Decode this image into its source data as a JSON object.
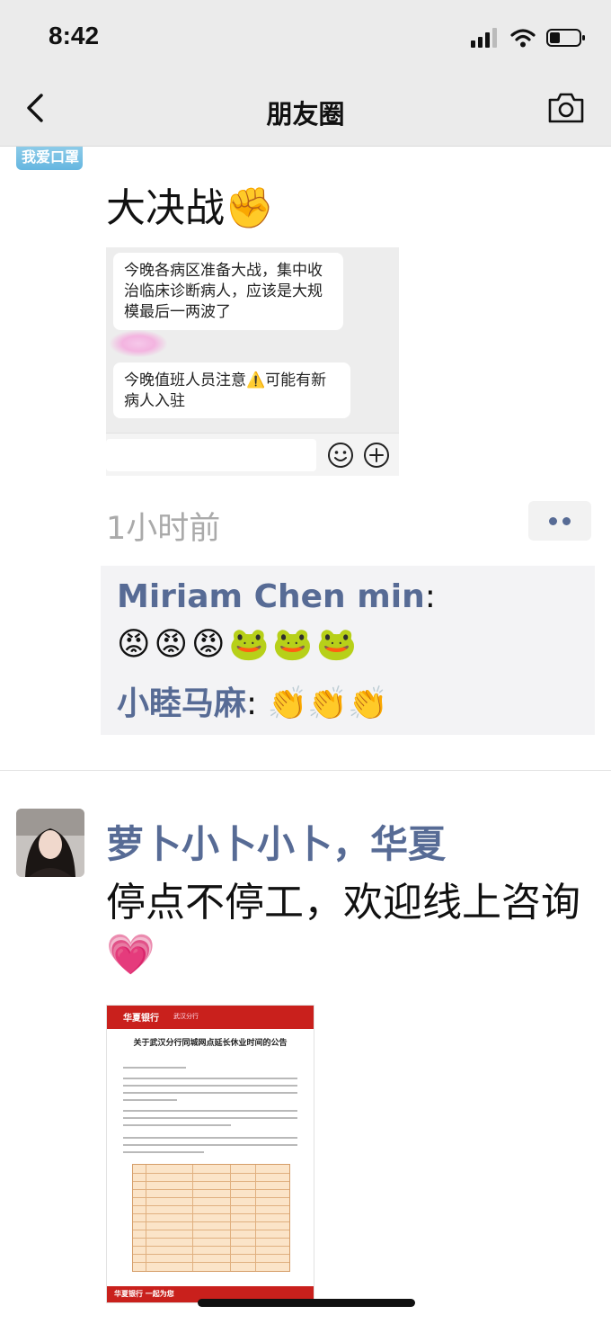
{
  "status_bar": {
    "time": "8:42",
    "battery_level": 0.35
  },
  "nav": {
    "title": "朋友圈",
    "back_icon": "chevron-left-icon",
    "camera_icon": "camera-icon"
  },
  "post1": {
    "avatar_text": "我爱口罩",
    "text": "大决战✊",
    "screenshot": {
      "message1": "今晚各病区准备大战，集中收治临床诊断病人，应该是大规模最后一两波了",
      "message2": "今晚值班人员注意⚠️可能有新病人入驻"
    },
    "time": "1小时前",
    "comments": [
      {
        "name": "Miriam Chen min",
        "text": "😡😡😡🐸🐸🐸"
      },
      {
        "name": "小睦马麻",
        "text": "👏👏👏"
      }
    ]
  },
  "post2": {
    "name": "萝卜小卜小卜，华夏",
    "text": "停点不停工，欢迎线上咨询💗",
    "notice": {
      "brand": "华夏银行",
      "branch": "武汉分行",
      "title": "关于武汉分行同城网点延长休业时间的公告",
      "footer": "华夏银行 一起为您"
    }
  },
  "colors": {
    "link": "#576b95",
    "header_bg": "#ebebeb",
    "comment_bg": "#f3f3f5",
    "time_gray": "#aaaaaa"
  }
}
